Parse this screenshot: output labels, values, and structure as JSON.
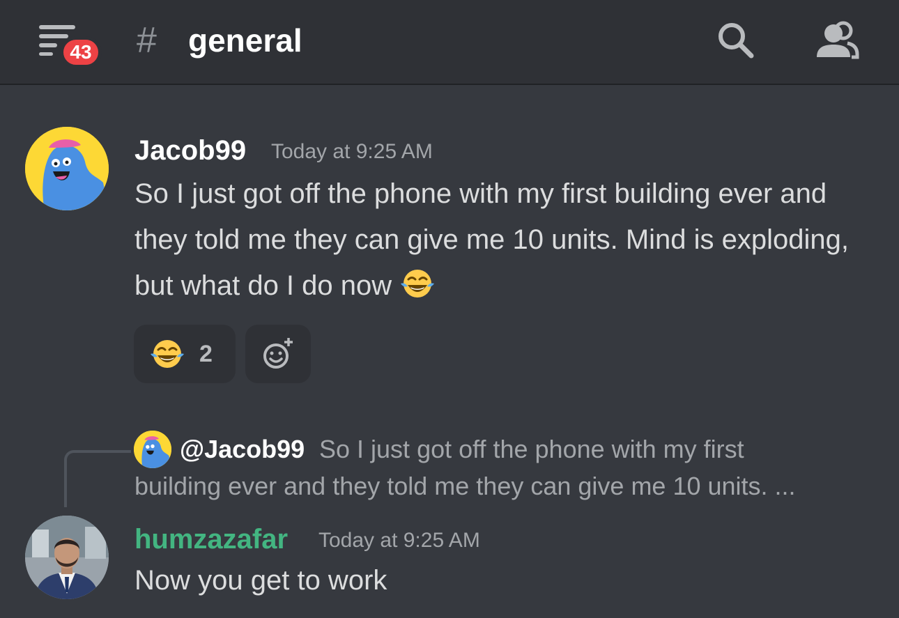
{
  "header": {
    "unread_badge": "43",
    "channel_hash": "#",
    "channel_name": "general",
    "icons": [
      "menu-icon",
      "search-icon",
      "members-icon"
    ]
  },
  "messages": [
    {
      "username": "Jacob99",
      "timestamp": "Today at 9:25 AM",
      "text": "So I just got off the phone with my first building ever and they told me they can give me 10 units. Mind is exploding, but what do I do now",
      "inline_emoji": "face-with-tears-of-joy",
      "reactions": [
        {
          "emoji": "face-with-tears-of-joy",
          "count": "2"
        }
      ],
      "add_reaction_icon": "add-reaction-icon"
    },
    {
      "reply_to": {
        "mention": "@Jacob99",
        "preview_line1": "So I just got off the phone with my first",
        "preview_line2": "building ever and they told me they can give me 10 units. ..."
      },
      "username": "humzazafar",
      "timestamp": "Today at 9:25 AM",
      "text": "Now you get to work"
    }
  ],
  "colors": {
    "background": "#36393f",
    "header": "#2f3136",
    "badge": "#ed4245",
    "username_green": "#43b581",
    "muted_text": "#a3a6aa"
  }
}
